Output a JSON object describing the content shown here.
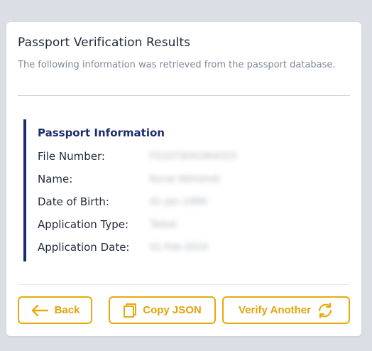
{
  "header": {
    "title": "Passport Verification Results",
    "subtitle": "The following information was retrieved from the passport database."
  },
  "info": {
    "heading": "Passport Information",
    "rows": [
      {
        "label": "File Number:",
        "value": "FS1073041964315"
      },
      {
        "label": "Name:",
        "value": "Kunal Abhishek"
      },
      {
        "label": "Date of Birth:",
        "value": "01-Jan-1999"
      },
      {
        "label": "Application Type:",
        "value": "Tatkal"
      },
      {
        "label": "Application Date:",
        "value": "01-Feb-2024"
      }
    ]
  },
  "actions": {
    "back_label": "Back",
    "back_icon": "arrow-left-icon",
    "copy_label": "Copy JSON",
    "copy_icon": "copy-icon",
    "verify_label": "Verify Another",
    "verify_icon": "refresh-icon"
  },
  "colors": {
    "accent": "#e8a90c",
    "heading": "#1c2d6e",
    "background": "#dcdee6"
  }
}
